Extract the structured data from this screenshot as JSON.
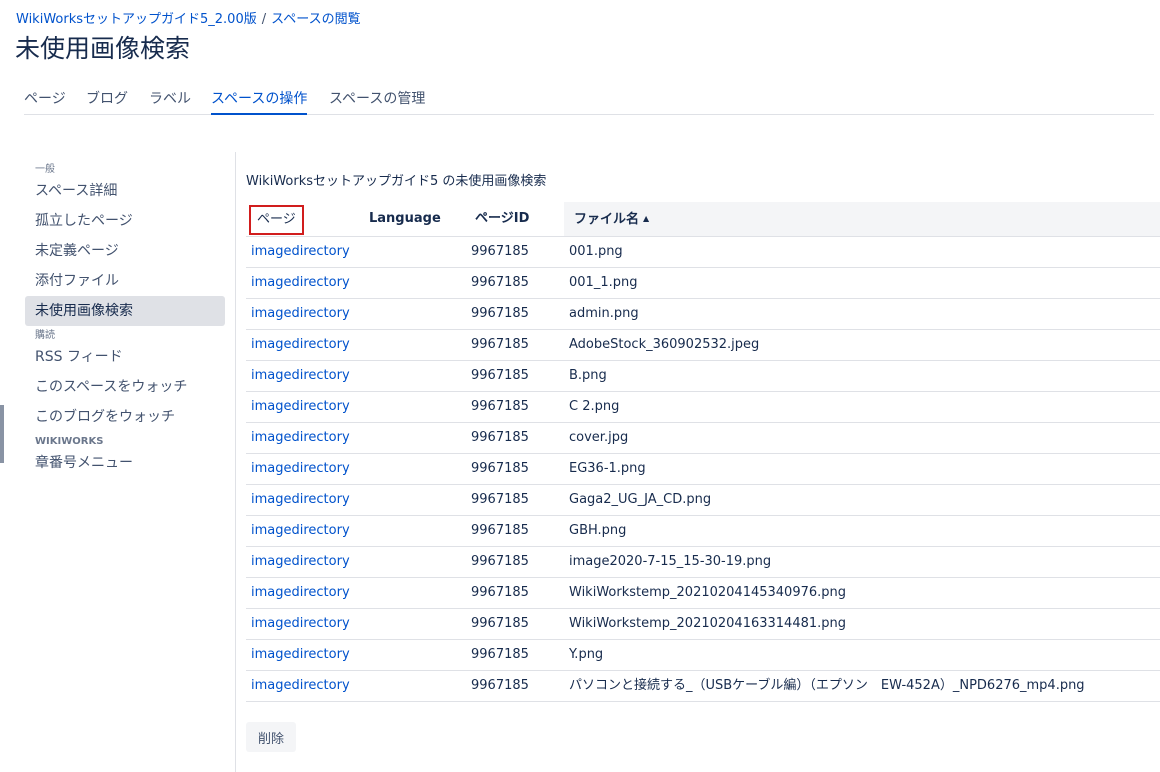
{
  "breadcrumb": {
    "space": "WikiWorksセットアップガイド5_2.00版",
    "separator": "/",
    "section": "スペースの閲覧"
  },
  "page_title": "未使用画像検索",
  "tabs": [
    {
      "label": "ページ",
      "active": false
    },
    {
      "label": "ブログ",
      "active": false
    },
    {
      "label": "ラベル",
      "active": false
    },
    {
      "label": "スペースの操作",
      "active": true
    },
    {
      "label": "スペースの管理",
      "active": false
    }
  ],
  "sidebar": {
    "general_heading": "一般",
    "general_items": [
      {
        "label": "スペース詳細",
        "active": false
      },
      {
        "label": "孤立したページ",
        "active": false
      },
      {
        "label": "未定義ページ",
        "active": false
      },
      {
        "label": "添付ファイル",
        "active": false
      },
      {
        "label": "未使用画像検索",
        "active": true
      }
    ],
    "subscribe_heading": "購読",
    "subscribe_items": [
      {
        "label": "RSS フィード"
      },
      {
        "label": "このスペースをウォッチ"
      },
      {
        "label": "このブログをウォッチ"
      }
    ],
    "wikiworks_heading": "WIKIWORKS",
    "wikiworks_items": [
      {
        "label": "章番号メニュー"
      }
    ]
  },
  "main": {
    "section_title": "WikiWorksセットアップガイド5 の未使用画像検索",
    "table": {
      "headers": {
        "page": "ページ",
        "language": "Language",
        "page_id": "ページID",
        "file_name": "ファイル名",
        "sort_indicator": "▲"
      },
      "rows": [
        {
          "page": "imagedirectory",
          "language": "",
          "page_id": "9967185",
          "file_name": "001.png"
        },
        {
          "page": "imagedirectory",
          "language": "",
          "page_id": "9967185",
          "file_name": "001_1.png"
        },
        {
          "page": "imagedirectory",
          "language": "",
          "page_id": "9967185",
          "file_name": "admin.png"
        },
        {
          "page": "imagedirectory",
          "language": "",
          "page_id": "9967185",
          "file_name": "AdobeStock_360902532.jpeg"
        },
        {
          "page": "imagedirectory",
          "language": "",
          "page_id": "9967185",
          "file_name": "B.png"
        },
        {
          "page": "imagedirectory",
          "language": "",
          "page_id": "9967185",
          "file_name": "C 2.png"
        },
        {
          "page": "imagedirectory",
          "language": "",
          "page_id": "9967185",
          "file_name": "cover.jpg"
        },
        {
          "page": "imagedirectory",
          "language": "",
          "page_id": "9967185",
          "file_name": "EG36-1.png"
        },
        {
          "page": "imagedirectory",
          "language": "",
          "page_id": "9967185",
          "file_name": "Gaga2_UG_JA_CD.png"
        },
        {
          "page": "imagedirectory",
          "language": "",
          "page_id": "9967185",
          "file_name": "GBH.png"
        },
        {
          "page": "imagedirectory",
          "language": "",
          "page_id": "9967185",
          "file_name": "image2020-7-15_15-30-19.png"
        },
        {
          "page": "imagedirectory",
          "language": "",
          "page_id": "9967185",
          "file_name": "WikiWorkstemp_20210204145340976.png"
        },
        {
          "page": "imagedirectory",
          "language": "",
          "page_id": "9967185",
          "file_name": "WikiWorkstemp_20210204163314481.png"
        },
        {
          "page": "imagedirectory",
          "language": "",
          "page_id": "9967185",
          "file_name": "Y.png"
        },
        {
          "page": "imagedirectory",
          "language": "",
          "page_id": "9967185",
          "file_name": "パソコンと接続する_（USBケーブル編）（エプソン　EW-452A）_NPD6276_mp4.png"
        }
      ]
    },
    "delete_button": "削除"
  },
  "colors": {
    "link": "#0052cc",
    "text": "#172b4d",
    "subtle_text": "#42526e",
    "border": "#dfe1e6",
    "active_bg": "#dfe1e6",
    "header_bg": "#f4f5f7",
    "highlight_box": "#d11d1d"
  }
}
